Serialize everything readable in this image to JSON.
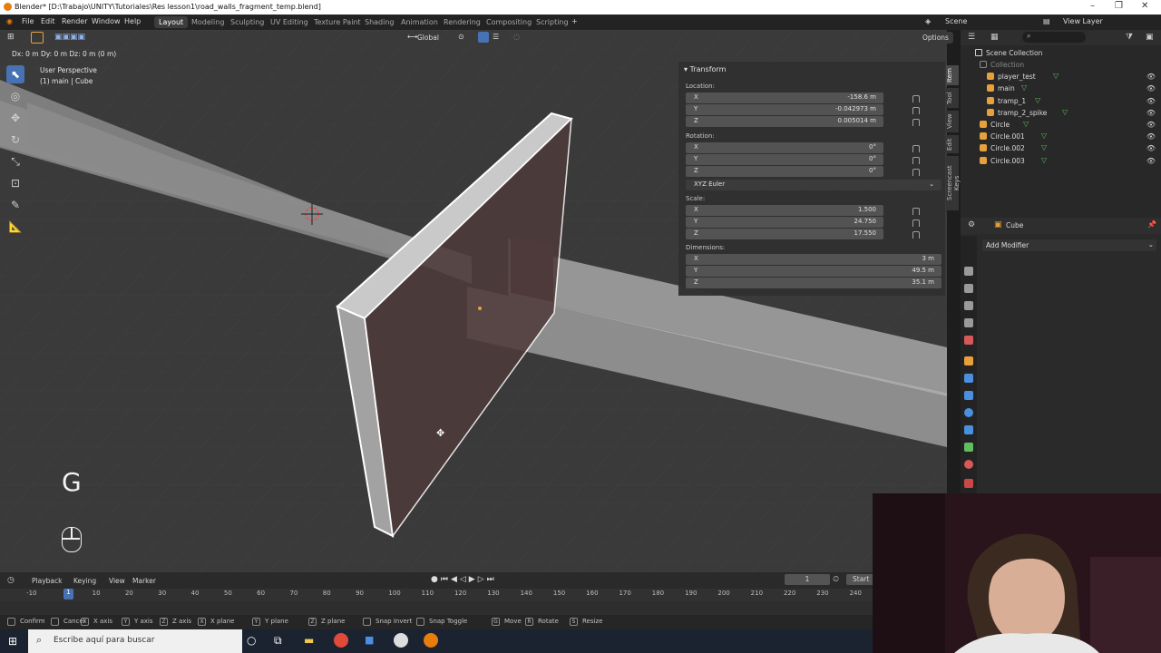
{
  "window": {
    "title": "Blender* [D:\\Trabajo\\UNITY\\Tutoriales\\Res lesson1\\road_walls_fragment_temp.blend]"
  },
  "menu": {
    "items": [
      "File",
      "Edit",
      "Render",
      "Window",
      "Help"
    ],
    "workspaces": [
      "Layout",
      "Modeling",
      "Sculpting",
      "UV Editing",
      "Texture Paint",
      "Shading",
      "Animation",
      "Rendering",
      "Compositing",
      "Scripting"
    ],
    "active_workspace": "Layout",
    "scene": "Scene",
    "view_layer": "View Layer"
  },
  "viewport": {
    "transform_orientation": "Global",
    "options_label": "Options",
    "delta_readout": "Dx: 0 m   Dy: 0 m   Dz: 0 m (0 m)",
    "view_name": "User Perspective",
    "object_info": "(1) main | Cube",
    "key_overlay": "G",
    "tabs": [
      "Item",
      "Tool",
      "View",
      "Edit",
      "Screencast Keys"
    ]
  },
  "transform": {
    "header": "Transform",
    "location_label": "Location:",
    "location": [
      {
        "axis": "X",
        "value": "-158.6 m"
      },
      {
        "axis": "Y",
        "value": "-0.042973 m"
      },
      {
        "axis": "Z",
        "value": "0.005014 m"
      }
    ],
    "rotation_label": "Rotation:",
    "rotation": [
      {
        "axis": "X",
        "value": "0°"
      },
      {
        "axis": "Y",
        "value": "0°"
      },
      {
        "axis": "Z",
        "value": "0°"
      }
    ],
    "rotation_mode": "XYZ Euler",
    "scale_label": "Scale:",
    "scale": [
      {
        "axis": "X",
        "value": "1.500"
      },
      {
        "axis": "Y",
        "value": "24.750"
      },
      {
        "axis": "Z",
        "value": "17.550"
      }
    ],
    "dimensions_label": "Dimensions:",
    "dimensions": [
      {
        "axis": "X",
        "value": "3 m"
      },
      {
        "axis": "Y",
        "value": "49.5 m"
      },
      {
        "axis": "Z",
        "value": "35.1 m"
      }
    ]
  },
  "outliner": {
    "root": "Scene Collection",
    "items": [
      {
        "name": "Collection",
        "dim": true
      },
      {
        "name": "player_test",
        "dim": false
      },
      {
        "name": "main",
        "dim": false
      },
      {
        "name": "tramp_1",
        "dim": false
      },
      {
        "name": "tramp_2_spike",
        "dim": false
      },
      {
        "name": "Circle",
        "dim": false
      },
      {
        "name": "Circle.001",
        "dim": false
      },
      {
        "name": "Circle.002",
        "dim": false
      },
      {
        "name": "Circle.003",
        "dim": false
      }
    ]
  },
  "properties": {
    "object_name": "Cube",
    "add_modifier": "Add Modifier"
  },
  "timeline": {
    "menus": [
      "Playback",
      "Keying",
      "View",
      "Marker"
    ],
    "current_frame": "1",
    "start_label": "Start",
    "current_frame_marker": "1",
    "ticks": [
      "-10",
      "10",
      "20",
      "30",
      "40",
      "50",
      "60",
      "70",
      "80",
      "90",
      "100",
      "110",
      "120",
      "130",
      "140",
      "150",
      "160",
      "170",
      "180",
      "190",
      "200",
      "210",
      "220",
      "230",
      "240"
    ]
  },
  "statusbar": {
    "items": [
      "Confirm",
      "Cancel",
      "X axis",
      "Y axis",
      "Z axis",
      "X plane",
      "Y plane",
      "Z plane",
      "Snap Invert",
      "Snap Toggle",
      "Move",
      "Rotate",
      "Resize"
    ],
    "keys": [
      "",
      "",
      "X",
      "Y",
      "Z",
      "X",
      "Y",
      "Z",
      "",
      "",
      "G",
      "R",
      "S"
    ]
  },
  "taskbar": {
    "search_placeholder": "Escribe aquí para buscar"
  },
  "colors": {
    "accent": "#4772b3",
    "selected_outline": "#ffffff",
    "object_orange": "#e8a03a",
    "mesh_green": "#5fbf5f"
  }
}
